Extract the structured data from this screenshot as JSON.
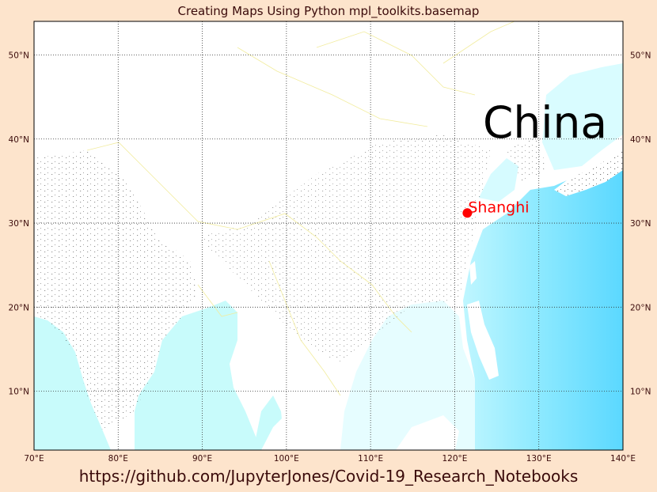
{
  "title": "Creating Maps Using Python mpl_toolkits.basemap",
  "footer_url": "https://github.com/JupyterJones/Covid-19_Research_Notebooks",
  "map": {
    "projection": "cylindrical",
    "lon_range": [
      70,
      140
    ],
    "lat_range": [
      3,
      54
    ],
    "meridians": [
      70,
      80,
      90,
      100,
      110,
      120,
      130,
      140
    ],
    "parallels": [
      10,
      20,
      30,
      40,
      50
    ],
    "meridian_labels": [
      "70°E",
      "80°E",
      "90°E",
      "100°E",
      "110°E",
      "120°E",
      "130°E",
      "140°E"
    ],
    "parallel_labels": [
      "10°N",
      "20°N",
      "30°N",
      "40°N",
      "50°N"
    ],
    "country_label": "China",
    "marker": {
      "name": "Shanghi",
      "lon": 121.5,
      "lat": 31.2,
      "color": "#ff0000"
    },
    "colors": {
      "land": "#ffffff",
      "ocean_light": "#c8fbfb",
      "ocean_deep": "#4fd6ff",
      "grid": "#333333",
      "borders": "#f0e890"
    }
  }
}
